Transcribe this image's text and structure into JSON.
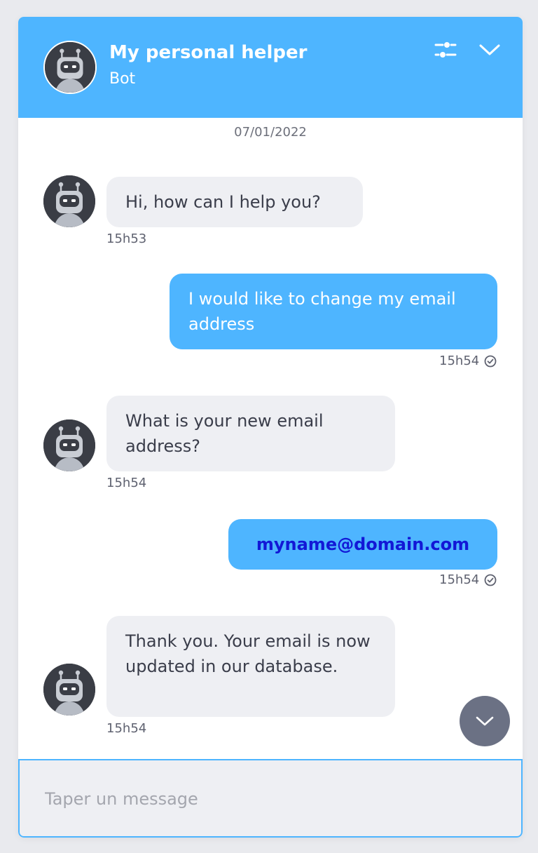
{
  "header": {
    "title": "My personal helper",
    "subtitle": "Bot",
    "background_color": "#4eb5ff",
    "settings_icon": "sliders-icon",
    "collapse_icon": "chevron-down-icon"
  },
  "conversation": {
    "date": "07/01/2022",
    "messages": [
      {
        "sender": "bot",
        "text": "Hi, how can I help you?",
        "time": "15h53"
      },
      {
        "sender": "user",
        "text": "I would like to change my email address",
        "time": "15h54",
        "status_icon": "check-circle-icon"
      },
      {
        "sender": "bot",
        "text": "What is your new email address?",
        "time": "15h54"
      },
      {
        "sender": "user",
        "text": "myname@domain.com",
        "time": "15h54",
        "status_icon": "check-circle-icon"
      },
      {
        "sender": "bot",
        "text": "Thank you. Your email is now updated in our database.",
        "time": "15h54"
      }
    ]
  },
  "scroll_button": {
    "icon": "chevron-down-icon"
  },
  "composer": {
    "placeholder": "Taper un message",
    "value": ""
  },
  "colors": {
    "accent": "#4eb5ff",
    "bot_bubble": "#eeeff3",
    "link_text": "#1218d6",
    "scroll_button": "#6b7184"
  }
}
